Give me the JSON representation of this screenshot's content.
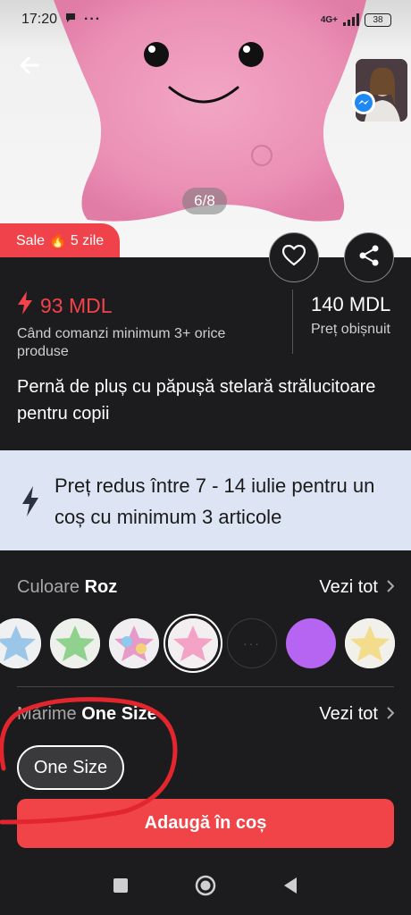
{
  "status_bar": {
    "time": "17:20",
    "network": "4G+",
    "battery": "38"
  },
  "gallery": {
    "counter": "6/8"
  },
  "sale_badge": {
    "text": "Sale 🔥 5 zile"
  },
  "price": {
    "current": "93 MDL",
    "condition": "Când comanzi minimum 3+ orice produse",
    "regular": "140 MDL",
    "regular_label": "Preț obișnuit"
  },
  "product": {
    "title": "Pernă de pluș cu păpușă stelară strălucitoare pentru copii"
  },
  "promo": {
    "text": "Preț redus între 7 - 14 iulie pentru un coș cu minimum 3 articole"
  },
  "color_option": {
    "label": "Culoare",
    "value": "Roz",
    "see_all": "Vezi tot",
    "swatches": [
      "blue",
      "green",
      "multicolor",
      "pink",
      "placeholder",
      "purple",
      "yellow"
    ],
    "selected_index": 3
  },
  "size_option": {
    "label": "Mărime",
    "value": "One Size",
    "see_all": "Vezi tot",
    "chip": "One Size"
  },
  "cart": {
    "button_label": "Adaugă în coș"
  },
  "colors": {
    "accent_red": "#f04449",
    "promo_bg": "#dde5f4",
    "background": "#1c1c1e",
    "selected_swatch": "#f4a3c6",
    "purple_swatch": "#b565f2"
  }
}
